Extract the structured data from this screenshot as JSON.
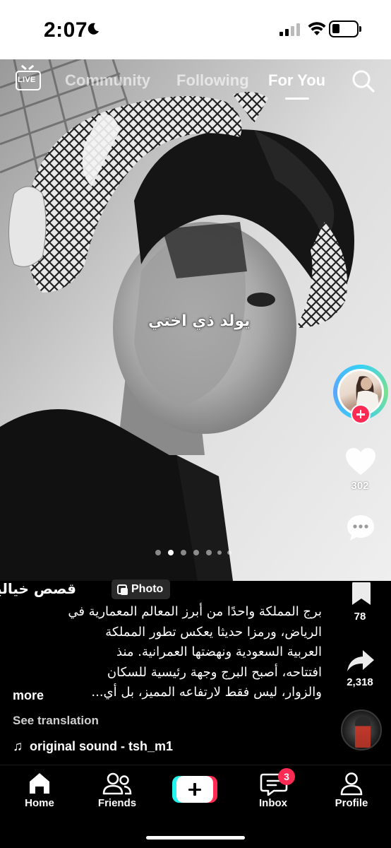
{
  "status_bar": {
    "time": "2:07"
  },
  "top_nav": {
    "live_label": "LIVE",
    "tabs": [
      {
        "label": "Community"
      },
      {
        "label": "Following"
      },
      {
        "label": "For You"
      }
    ]
  },
  "post": {
    "overlay_caption": "يولد ذي اختي",
    "carousel": {
      "count": 7,
      "active_index": 1
    },
    "author": "قصص خياليه",
    "media_type_badge": "Photo",
    "description_lines": [
      "برج المملكة واحدًا من أبرز المعالم المعمارية في",
      "الرياض، ورمزا حديثا يعكس تطور المملكة",
      "العربية السعودية ونهضتها العمرانية. منذ",
      "افتتاحه، أصبح البرج وجهة رئيسية للسكان",
      "والزوار، ليس فقط لارتفاعه المميز، بل أي..."
    ],
    "more_label": "more",
    "see_translation": "See translation",
    "sound": "original sound - tsh_m1"
  },
  "actions": {
    "likes": "302",
    "bookmarks": "78",
    "shares": "2,318"
  },
  "bottom_tabs": {
    "home": "Home",
    "friends": "Friends",
    "inbox": "Inbox",
    "inbox_badge": "3",
    "profile": "Profile"
  },
  "colors": {
    "accent_red": "#fe2c55",
    "accent_cyan": "#25f4ee",
    "background": "#000000"
  }
}
